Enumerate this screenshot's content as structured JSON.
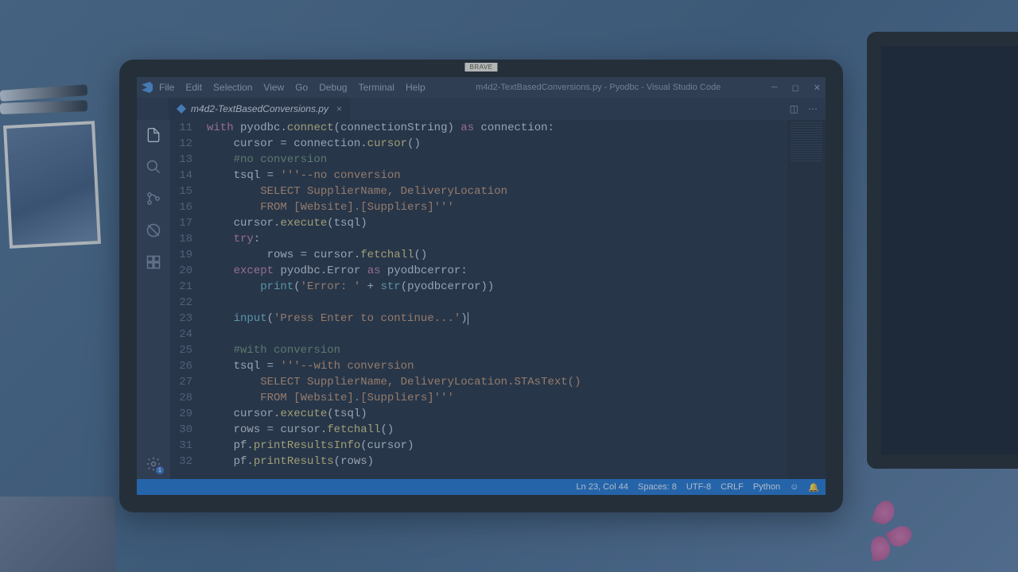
{
  "webcam_sticker": "BRAVE",
  "menu": [
    "File",
    "Edit",
    "Selection",
    "View",
    "Go",
    "Debug",
    "Terminal",
    "Help"
  ],
  "window_title": "m4d2-TextBasedConversions.py - Pyodbc - Visual Studio Code",
  "tab": {
    "name": "m4d2-TextBasedConversions.py"
  },
  "gear_badge": "1",
  "code_lines": [
    {
      "n": 11,
      "html": "<span class='kw'>with</span> <span class='var'>pyodbc</span>.<span class='fn'>connect</span>(<span class='var'>connectionString</span>) <span class='kw'>as</span> <span class='var'>connection</span>:"
    },
    {
      "n": 12,
      "html": "    <span class='var'>cursor</span> = <span class='var'>connection</span>.<span class='fn'>cursor</span>()"
    },
    {
      "n": 13,
      "html": "    <span class='com'>#no conversion</span>"
    },
    {
      "n": 14,
      "html": "    <span class='var'>tsql</span> = <span class='str'>'''--no conversion</span>"
    },
    {
      "n": 15,
      "html": "        <span class='str'>SELECT SupplierName, DeliveryLocation</span>"
    },
    {
      "n": 16,
      "html": "        <span class='str'>FROM [Website].[Suppliers]'''</span>"
    },
    {
      "n": 17,
      "html": "    <span class='var'>cursor</span>.<span class='fn'>execute</span>(<span class='var'>tsql</span>)"
    },
    {
      "n": 18,
      "html": "    <span class='kw'>try</span>:"
    },
    {
      "n": 19,
      "html": "         <span class='var'>rows</span> = <span class='var'>cursor</span>.<span class='fn'>fetchall</span>()"
    },
    {
      "n": 20,
      "html": "    <span class='kw'>except</span> <span class='var'>pyodbc</span>.<span class='var'>Error</span> <span class='kw'>as</span> <span class='var'>pyodbcerror</span>:"
    },
    {
      "n": 21,
      "html": "        <span class='builtin'>print</span>(<span class='str'>'Error: '</span> + <span class='builtin'>str</span>(<span class='var'>pyodbcerror</span>))"
    },
    {
      "n": 22,
      "html": ""
    },
    {
      "n": 23,
      "html": "    <span class='builtin'>input</span>(<span class='str'>'Press Enter to continue...'</span>)<span class='cursor-mark'></span>"
    },
    {
      "n": 24,
      "html": ""
    },
    {
      "n": 25,
      "html": "    <span class='com'>#with conversion</span>"
    },
    {
      "n": 26,
      "html": "    <span class='var'>tsql</span> = <span class='str'>'''--with conversion</span>"
    },
    {
      "n": 27,
      "html": "        <span class='str'>SELECT SupplierName, DeliveryLocation.STAsText()</span>"
    },
    {
      "n": 28,
      "html": "        <span class='str'>FROM [Website].[Suppliers]'''</span>"
    },
    {
      "n": 29,
      "html": "    <span class='var'>cursor</span>.<span class='fn'>execute</span>(<span class='var'>tsql</span>)"
    },
    {
      "n": 30,
      "html": "    <span class='var'>rows</span> = <span class='var'>cursor</span>.<span class='fn'>fetchall</span>()"
    },
    {
      "n": 31,
      "html": "    <span class='var'>pf</span>.<span class='fn'>printResultsInfo</span>(<span class='var'>cursor</span>)"
    },
    {
      "n": 32,
      "html": "    <span class='var'>pf</span>.<span class='fn'>printResults</span>(<span class='var'>rows</span>)"
    }
  ],
  "status": {
    "left": [],
    "right": [
      "Ln 23, Col 44",
      "Spaces: 8",
      "UTF-8",
      "CRLF",
      "Python",
      "☺",
      "🔔"
    ]
  }
}
